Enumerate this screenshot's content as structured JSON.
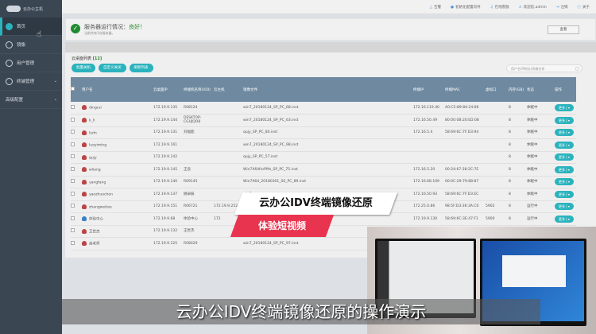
{
  "sidebar": {
    "logo": "云办公主机",
    "items": [
      {
        "label": "首页"
      },
      {
        "label": "镜像"
      },
      {
        "label": "用户管理"
      },
      {
        "label": "终端管理"
      },
      {
        "label": "高级配置"
      }
    ]
  },
  "topbar": {
    "items": [
      "告警",
      "初始化配置向导",
      "在线客服",
      "欢迎您,admin",
      "注销",
      "关于"
    ]
  },
  "status": {
    "title": "服务器运行情况：",
    "value": "良好！",
    "sub": "当前共有1台服务器。",
    "view": "查看"
  },
  "list": {
    "title": "云桌面列表",
    "count": "[12]",
    "buttons": [
      "批量关机",
      "自定义关闭",
      "刷新列表"
    ],
    "search_placeholder": "用户名/IP地址/终端名称",
    "headers": [
      "用户名",
      "云桌面IP",
      "终端机名称(VDI)",
      "云主机",
      "镜像文件",
      "终端IP",
      "终端MAC",
      "虚拟口",
      "内存(GB)",
      "状态",
      "操作"
    ],
    "action_label": "更多",
    "rows": [
      [
        "dingrui",
        "172.19.9.135",
        "R08124",
        "",
        "win7_20180124_SP_PC_68.inst",
        "172.16.119.40",
        "A0:C5:89:84:24:86",
        "",
        "8",
        "休眠中"
      ],
      [
        "k_li",
        "172.19.9.144",
        "DESKTOP-CGUJQO8",
        "",
        "win7_20180124_SP_PC_63.inst",
        "172.16.50.49",
        "80:00:0B:20:ED:08",
        "",
        "8",
        "休眠中"
      ],
      [
        "liufn",
        "172.19.9.131",
        "刘福能",
        "",
        "qujy_SP_PC_80.inst",
        "172.16.5.4",
        "58:69:6C:7F:D3:94",
        "",
        "8",
        "休眠中"
      ],
      [
        "luoyiming",
        "172.19.9.161",
        "",
        "",
        "win7_20180124_SP_PC_98.inst",
        "",
        "",
        "",
        "8",
        "休眠中"
      ],
      [
        "qujy",
        "172.19.9.142",
        "",
        "",
        "qujy_SP_PC_57.inst",
        "",
        "",
        "",
        "8",
        "休眠中"
      ],
      [
        "wliang",
        "172.19.9.145",
        "王良",
        "",
        "Win7X64forPMs_SP_PC_75.inst",
        "172.16.5.20",
        "00:24:67:38:2C:7E",
        "",
        "8",
        "休眠中"
      ],
      [
        "yangfang",
        "172.19.9.140",
        "R09145",
        "",
        "Win7X64_20180301_S0_PC_89.inst",
        "172.16.68.109",
        "00:0C:29:79:88:87",
        "",
        "8",
        "休眠中"
      ],
      [
        "yaozhuochen",
        "172.19.9.137",
        "姚卓辰",
        "",
        "win7",
        "172.16.50.93",
        "58:69:6C:7F:D3:EC",
        "",
        "8",
        "休眠中"
      ],
      [
        "zhangweitao",
        "172.19.9.151",
        "R06721",
        "172.19.9.252",
        "",
        "172.25.0.86",
        "98:5F:D3:36:3A:C0",
        "5902",
        "8",
        "运行中"
      ],
      [
        "体验中心",
        "172.19.9.68",
        "体验中心",
        "172",
        "",
        "172.19.9.130",
        "58:69:6C:3E:47:F1",
        "5900",
        "8",
        "运行中"
      ],
      [
        "王世杰",
        "172.19.9.132",
        "王世杰",
        "",
        "",
        "",
        "",
        "",
        "",
        ""
      ],
      [
        "高老师",
        "172.19.9.125",
        "R08029",
        "",
        "win7_20180124_SP_PC_97.inst",
        "",
        "",
        "",
        "",
        ""
      ]
    ]
  },
  "overlay": {
    "banner_title": "云办公IDV终端镜像还原",
    "banner_sub": "体验短视频",
    "caption": "云办公IDV终端镜像还原的操作演示"
  },
  "colors": {
    "accent": "#2bb3bd",
    "header": "#6f8aa0",
    "sidebar": "#3b4653",
    "banner_red": "#e8344e"
  }
}
